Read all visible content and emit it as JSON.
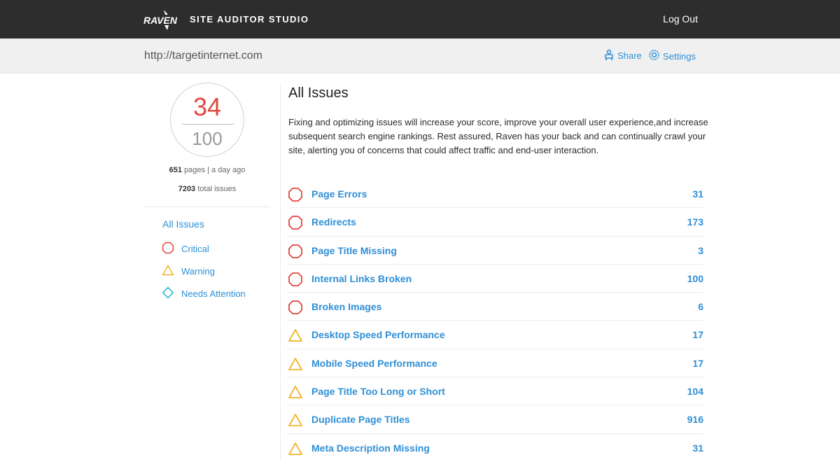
{
  "header": {
    "logo_text": "RAVEN",
    "app_title": "SITE AUDITOR STUDIO",
    "logout_label": "Log Out"
  },
  "urlbar": {
    "url": "http://targetinternet.com",
    "share_label": "Share",
    "settings_label": "Settings"
  },
  "sidebar": {
    "score": "34",
    "score_max": "100",
    "pages_count": "651",
    "pages_suffix": "pages",
    "separator": "|",
    "last_crawl": "a day ago",
    "total_issues": "7203",
    "total_issues_suffix": "total issues",
    "nav_title": "All Issues",
    "filters": [
      {
        "label": "Critical",
        "icon": "octagon-icon"
      },
      {
        "label": "Warning",
        "icon": "triangle-icon"
      },
      {
        "label": "Needs Attention",
        "icon": "diamond-icon"
      }
    ]
  },
  "main": {
    "title": "All Issues",
    "description": "Fixing and optimizing issues will increase your score, improve your overall user experience,and increase subsequent search engine rankings. Rest assured, Raven has your back and can continually crawl your site, alerting you of concerns that could affect traffic and end-user interaction.",
    "issues": [
      {
        "label": "Page Errors",
        "count": "31",
        "severity": "critical"
      },
      {
        "label": "Redirects",
        "count": "173",
        "severity": "critical"
      },
      {
        "label": "Page Title Missing",
        "count": "3",
        "severity": "critical"
      },
      {
        "label": "Internal Links Broken",
        "count": "100",
        "severity": "critical"
      },
      {
        "label": "Broken Images",
        "count": "6",
        "severity": "critical"
      },
      {
        "label": "Desktop Speed Performance",
        "count": "17",
        "severity": "warning"
      },
      {
        "label": "Mobile Speed Performance",
        "count": "17",
        "severity": "warning"
      },
      {
        "label": "Page Title Too Long or Short",
        "count": "104",
        "severity": "warning"
      },
      {
        "label": "Duplicate Page Titles",
        "count": "916",
        "severity": "warning"
      },
      {
        "label": "Meta Description Missing",
        "count": "31",
        "severity": "warning"
      }
    ]
  },
  "colors": {
    "topbar": "#2d2d2d",
    "accent": "#2e8fd6",
    "score": "#e0483e",
    "critical": "#e0483e",
    "warning": "#f0b429",
    "attention": "#1ab6c8"
  }
}
